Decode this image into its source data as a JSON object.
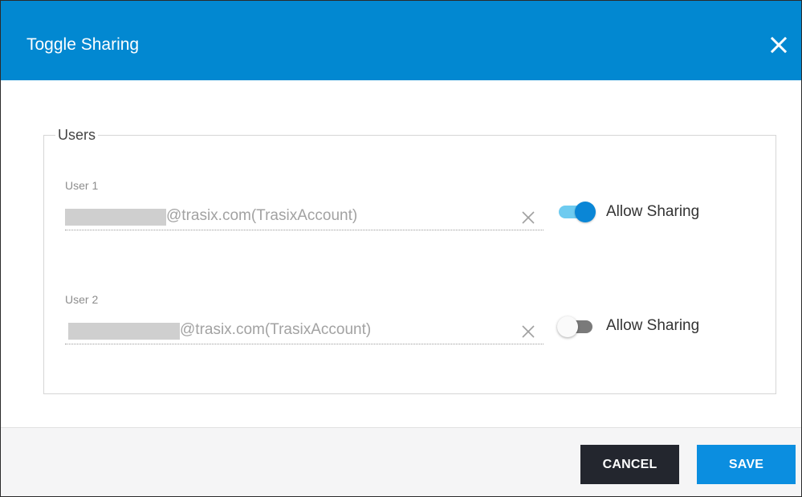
{
  "dialog": {
    "title": "Toggle Sharing",
    "header_color": "#0288d1",
    "close_icon": "close-icon"
  },
  "users_group": {
    "legend": "Users",
    "users": [
      {
        "label": "User 1",
        "value": "@trasix.com(TrasixAccount)",
        "clear_icon": "clear-icon",
        "sharing_enabled": true,
        "toggle_label": "Allow Sharing"
      },
      {
        "label": "User 2",
        "value": "@trasix.com(TrasixAccount)",
        "clear_icon": "clear-icon",
        "sharing_enabled": false,
        "toggle_label": "Allow Sharing"
      }
    ]
  },
  "footer": {
    "cancel_label": "CANCEL",
    "save_label": "SAVE",
    "cancel_color": "#23262e",
    "save_color": "#0b8ee0"
  }
}
